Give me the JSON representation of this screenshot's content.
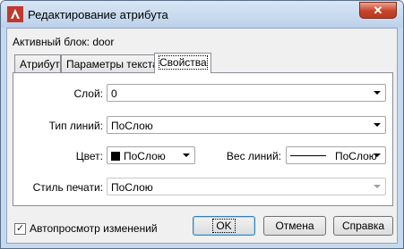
{
  "window": {
    "title": "Редактирование атрибута",
    "close_glyph": "✕"
  },
  "block_label": "Активный блок: door",
  "tabs": [
    {
      "label": "Атрибут"
    },
    {
      "label": "Параметры текста"
    },
    {
      "label": "Свойства"
    }
  ],
  "fields": {
    "layer": {
      "label": "Слой:",
      "value": "0"
    },
    "linetype": {
      "label": "Тип линий:",
      "value": "ПоСлою"
    },
    "color": {
      "label": "Цвет:",
      "value": "ПоСлою",
      "swatch_color": "#000000"
    },
    "lineweight": {
      "label": "Вес линий:",
      "value": "ПоСлою"
    },
    "plot_style": {
      "label": "Стиль печати:",
      "value": "ПоСлою"
    }
  },
  "preview": {
    "label": "Автопросмотр изменений",
    "checked_glyph": "✓"
  },
  "buttons": {
    "ok": "OK",
    "cancel": "Отмена",
    "help": "Справка"
  }
}
